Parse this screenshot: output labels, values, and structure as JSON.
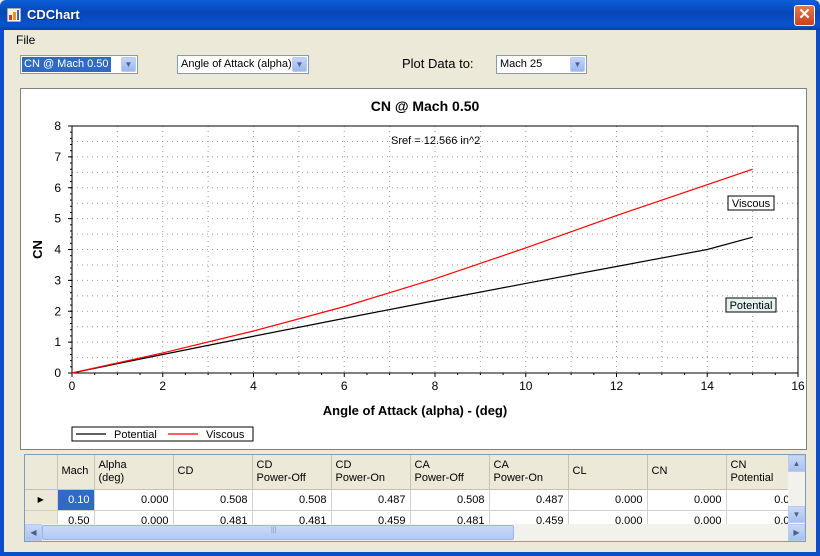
{
  "window": {
    "title": "CDChart",
    "close_glyph": "✕"
  },
  "menu": {
    "file": "File"
  },
  "toolbar": {
    "series_select": "CN @ Mach 0.50",
    "xaxis_select": "Angle of Attack (alpha)",
    "plot_label": "Plot Data to:",
    "mach_select": "Mach 25",
    "dropdown_glyph": "▼"
  },
  "chart_data": {
    "type": "line",
    "title": "CN @ Mach 0.50",
    "annotation": "Sref = 12.566 in^2",
    "xlabel": "Angle of Attack (alpha) - (deg)",
    "ylabel": "CN",
    "xlim": [
      0,
      16
    ],
    "ylim": [
      0,
      8
    ],
    "xticks": [
      "0",
      "2",
      "4",
      "6",
      "8",
      "10",
      "12",
      "14",
      "16"
    ],
    "yticks": [
      "0",
      "1",
      "2",
      "3",
      "4",
      "5",
      "6",
      "7",
      "8"
    ],
    "grid": true,
    "legend_position": "bottom-left",
    "series": [
      {
        "name": "Potential",
        "color": "#000000",
        "x": [
          0,
          2,
          4,
          6,
          8,
          10,
          12,
          14,
          15
        ],
        "y": [
          0,
          0.6,
          1.19,
          1.77,
          2.34,
          2.9,
          3.45,
          4.0,
          4.4
        ]
      },
      {
        "name": "Viscous",
        "color": "#ff0000",
        "x": [
          0,
          2,
          4,
          6,
          8,
          10,
          12,
          14,
          15
        ],
        "y": [
          0,
          0.65,
          1.36,
          2.15,
          3.05,
          4.05,
          5.1,
          6.1,
          6.6
        ]
      }
    ],
    "labels": [
      "Viscous",
      "Potential"
    ]
  },
  "table": {
    "columns": [
      "Mach",
      "Alpha\n(deg)",
      "CD",
      "CD\nPower-Off",
      "CD\nPower-On",
      "CA\nPower-Off",
      "CA\nPower-On",
      "CL",
      "CN",
      "CN\nPotential"
    ],
    "rows": [
      {
        "marker": "▶",
        "cells": [
          "0.10",
          "0.000",
          "0.508",
          "0.508",
          "0.487",
          "0.508",
          "0.487",
          "0.000",
          "0.000",
          "0.0"
        ]
      },
      {
        "marker": "",
        "cells": [
          "0.50",
          "0.000",
          "0.481",
          "0.481",
          "0.459",
          "0.481",
          "0.459",
          "0.000",
          "0.000",
          "0.0"
        ]
      }
    ]
  },
  "scroll": {
    "up": "▲",
    "down": "▼",
    "left": "◀",
    "right": "▶",
    "grip": "|||"
  }
}
